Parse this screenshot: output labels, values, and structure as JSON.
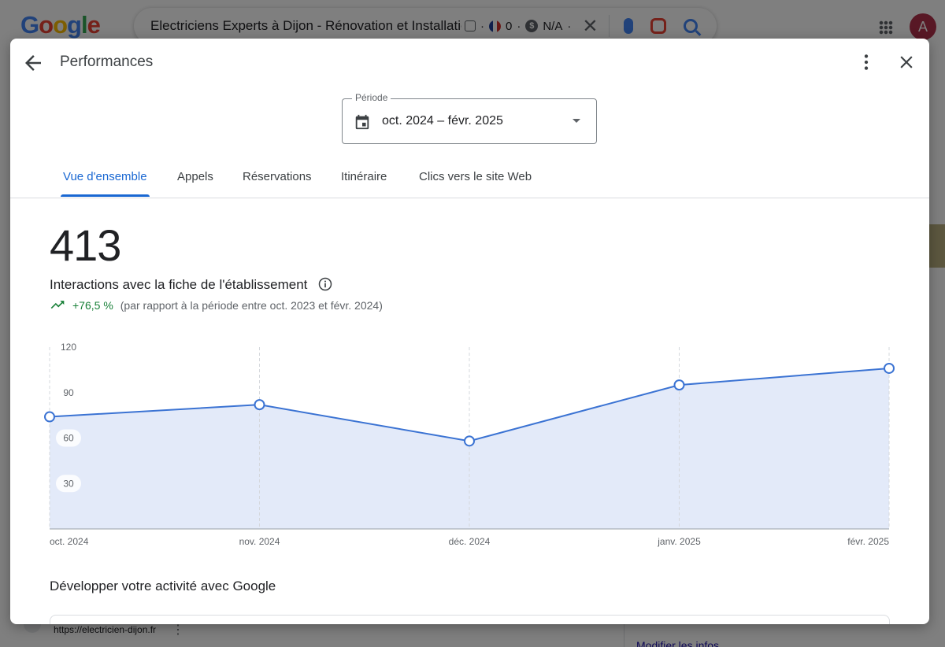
{
  "background": {
    "logo_letters": [
      "G",
      "o",
      "o",
      "g",
      "l",
      "e"
    ],
    "search_query": "Electriciens Experts à Dijon - Rénovation et Installation",
    "ext_count": "0",
    "ext_value": "N/A",
    "avatar_letter": "A",
    "result_url": "https://electricien-dijon.fr",
    "side_link": "Modifier les infos"
  },
  "dialog": {
    "title": "Performances",
    "period": {
      "label": "Période",
      "value": "oct. 2024 – févr. 2025"
    },
    "tabs": [
      {
        "label": "Vue d'ensemble",
        "active": true
      },
      {
        "label": "Appels",
        "active": false
      },
      {
        "label": "Réservations",
        "active": false
      },
      {
        "label": "Itinéraire",
        "active": false
      },
      {
        "label": "Clics vers le site Web",
        "active": false
      }
    ],
    "metric": {
      "total": "413",
      "label": "Interactions avec la fiche de l'établissement",
      "trend_value": "+76,5 %",
      "trend_note": "(par rapport à la période entre oct. 2023 et févr. 2024)"
    },
    "section_title": "Développer votre activité avec Google"
  },
  "colors": {
    "accent": "#1967d2",
    "line": "#3b73d3",
    "area": "#e3eaf9",
    "trend_up": "#188038"
  },
  "chart_data": {
    "type": "area",
    "categories": [
      "oct. 2024",
      "nov. 2024",
      "déc. 2024",
      "janv. 2025",
      "févr. 2025"
    ],
    "values": [
      74,
      82,
      58,
      95,
      106
    ],
    "y_ticks": [
      30,
      60,
      90,
      120
    ],
    "ylim": [
      0,
      120
    ],
    "grid": "vertical-dashed",
    "title": "",
    "xlabel": "",
    "ylabel": ""
  }
}
